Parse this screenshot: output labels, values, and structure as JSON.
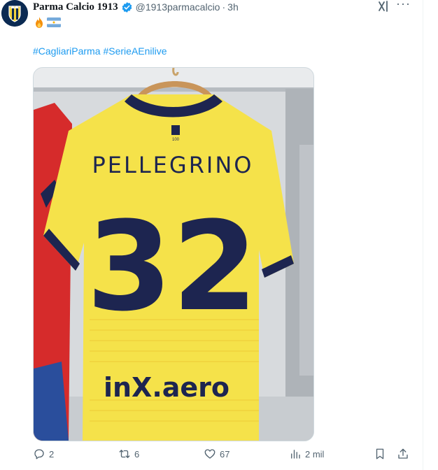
{
  "post": {
    "display_name": "Parma Calcio 1913",
    "handle": "@1913parmacalcio",
    "separator": "·",
    "time": "3h",
    "emojis": [
      "fire-emoji",
      "argentina-flag-emoji"
    ],
    "hashtags": [
      "#CagliariParma",
      "#SerieAEnilive"
    ],
    "media": {
      "jersey_name": "PELLEGRINO",
      "jersey_number": "32",
      "sponsor": "inX.aero"
    }
  },
  "actions": {
    "replies": "2",
    "reposts": "6",
    "likes": "67",
    "views": "2 mil"
  },
  "colors": {
    "link": "#1d9bf0",
    "muted": "#536471",
    "jersey_yellow": "#f5e24a",
    "jersey_navy": "#1d2550"
  }
}
